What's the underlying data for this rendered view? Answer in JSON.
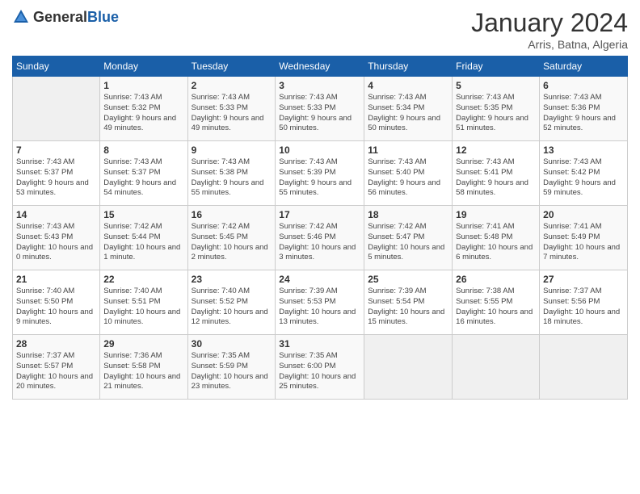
{
  "logo": {
    "general": "General",
    "blue": "Blue"
  },
  "title": "January 2024",
  "subtitle": "Arris, Batna, Algeria",
  "days_header": [
    "Sunday",
    "Monday",
    "Tuesday",
    "Wednesday",
    "Thursday",
    "Friday",
    "Saturday"
  ],
  "weeks": [
    [
      {
        "day": "",
        "sunrise": "",
        "sunset": "",
        "daylight": ""
      },
      {
        "day": "1",
        "sunrise": "Sunrise: 7:43 AM",
        "sunset": "Sunset: 5:32 PM",
        "daylight": "Daylight: 9 hours and 49 minutes."
      },
      {
        "day": "2",
        "sunrise": "Sunrise: 7:43 AM",
        "sunset": "Sunset: 5:33 PM",
        "daylight": "Daylight: 9 hours and 49 minutes."
      },
      {
        "day": "3",
        "sunrise": "Sunrise: 7:43 AM",
        "sunset": "Sunset: 5:33 PM",
        "daylight": "Daylight: 9 hours and 50 minutes."
      },
      {
        "day": "4",
        "sunrise": "Sunrise: 7:43 AM",
        "sunset": "Sunset: 5:34 PM",
        "daylight": "Daylight: 9 hours and 50 minutes."
      },
      {
        "day": "5",
        "sunrise": "Sunrise: 7:43 AM",
        "sunset": "Sunset: 5:35 PM",
        "daylight": "Daylight: 9 hours and 51 minutes."
      },
      {
        "day": "6",
        "sunrise": "Sunrise: 7:43 AM",
        "sunset": "Sunset: 5:36 PM",
        "daylight": "Daylight: 9 hours and 52 minutes."
      }
    ],
    [
      {
        "day": "7",
        "sunrise": "Sunrise: 7:43 AM",
        "sunset": "Sunset: 5:37 PM",
        "daylight": "Daylight: 9 hours and 53 minutes."
      },
      {
        "day": "8",
        "sunrise": "Sunrise: 7:43 AM",
        "sunset": "Sunset: 5:37 PM",
        "daylight": "Daylight: 9 hours and 54 minutes."
      },
      {
        "day": "9",
        "sunrise": "Sunrise: 7:43 AM",
        "sunset": "Sunset: 5:38 PM",
        "daylight": "Daylight: 9 hours and 55 minutes."
      },
      {
        "day": "10",
        "sunrise": "Sunrise: 7:43 AM",
        "sunset": "Sunset: 5:39 PM",
        "daylight": "Daylight: 9 hours and 55 minutes."
      },
      {
        "day": "11",
        "sunrise": "Sunrise: 7:43 AM",
        "sunset": "Sunset: 5:40 PM",
        "daylight": "Daylight: 9 hours and 56 minutes."
      },
      {
        "day": "12",
        "sunrise": "Sunrise: 7:43 AM",
        "sunset": "Sunset: 5:41 PM",
        "daylight": "Daylight: 9 hours and 58 minutes."
      },
      {
        "day": "13",
        "sunrise": "Sunrise: 7:43 AM",
        "sunset": "Sunset: 5:42 PM",
        "daylight": "Daylight: 9 hours and 59 minutes."
      }
    ],
    [
      {
        "day": "14",
        "sunrise": "Sunrise: 7:43 AM",
        "sunset": "Sunset: 5:43 PM",
        "daylight": "Daylight: 10 hours and 0 minutes."
      },
      {
        "day": "15",
        "sunrise": "Sunrise: 7:42 AM",
        "sunset": "Sunset: 5:44 PM",
        "daylight": "Daylight: 10 hours and 1 minute."
      },
      {
        "day": "16",
        "sunrise": "Sunrise: 7:42 AM",
        "sunset": "Sunset: 5:45 PM",
        "daylight": "Daylight: 10 hours and 2 minutes."
      },
      {
        "day": "17",
        "sunrise": "Sunrise: 7:42 AM",
        "sunset": "Sunset: 5:46 PM",
        "daylight": "Daylight: 10 hours and 3 minutes."
      },
      {
        "day": "18",
        "sunrise": "Sunrise: 7:42 AM",
        "sunset": "Sunset: 5:47 PM",
        "daylight": "Daylight: 10 hours and 5 minutes."
      },
      {
        "day": "19",
        "sunrise": "Sunrise: 7:41 AM",
        "sunset": "Sunset: 5:48 PM",
        "daylight": "Daylight: 10 hours and 6 minutes."
      },
      {
        "day": "20",
        "sunrise": "Sunrise: 7:41 AM",
        "sunset": "Sunset: 5:49 PM",
        "daylight": "Daylight: 10 hours and 7 minutes."
      }
    ],
    [
      {
        "day": "21",
        "sunrise": "Sunrise: 7:40 AM",
        "sunset": "Sunset: 5:50 PM",
        "daylight": "Daylight: 10 hours and 9 minutes."
      },
      {
        "day": "22",
        "sunrise": "Sunrise: 7:40 AM",
        "sunset": "Sunset: 5:51 PM",
        "daylight": "Daylight: 10 hours and 10 minutes."
      },
      {
        "day": "23",
        "sunrise": "Sunrise: 7:40 AM",
        "sunset": "Sunset: 5:52 PM",
        "daylight": "Daylight: 10 hours and 12 minutes."
      },
      {
        "day": "24",
        "sunrise": "Sunrise: 7:39 AM",
        "sunset": "Sunset: 5:53 PM",
        "daylight": "Daylight: 10 hours and 13 minutes."
      },
      {
        "day": "25",
        "sunrise": "Sunrise: 7:39 AM",
        "sunset": "Sunset: 5:54 PM",
        "daylight": "Daylight: 10 hours and 15 minutes."
      },
      {
        "day": "26",
        "sunrise": "Sunrise: 7:38 AM",
        "sunset": "Sunset: 5:55 PM",
        "daylight": "Daylight: 10 hours and 16 minutes."
      },
      {
        "day": "27",
        "sunrise": "Sunrise: 7:37 AM",
        "sunset": "Sunset: 5:56 PM",
        "daylight": "Daylight: 10 hours and 18 minutes."
      }
    ],
    [
      {
        "day": "28",
        "sunrise": "Sunrise: 7:37 AM",
        "sunset": "Sunset: 5:57 PM",
        "daylight": "Daylight: 10 hours and 20 minutes."
      },
      {
        "day": "29",
        "sunrise": "Sunrise: 7:36 AM",
        "sunset": "Sunset: 5:58 PM",
        "daylight": "Daylight: 10 hours and 21 minutes."
      },
      {
        "day": "30",
        "sunrise": "Sunrise: 7:35 AM",
        "sunset": "Sunset: 5:59 PM",
        "daylight": "Daylight: 10 hours and 23 minutes."
      },
      {
        "day": "31",
        "sunrise": "Sunrise: 7:35 AM",
        "sunset": "Sunset: 6:00 PM",
        "daylight": "Daylight: 10 hours and 25 minutes."
      },
      {
        "day": "",
        "sunrise": "",
        "sunset": "",
        "daylight": ""
      },
      {
        "day": "",
        "sunrise": "",
        "sunset": "",
        "daylight": ""
      },
      {
        "day": "",
        "sunrise": "",
        "sunset": "",
        "daylight": ""
      }
    ]
  ]
}
